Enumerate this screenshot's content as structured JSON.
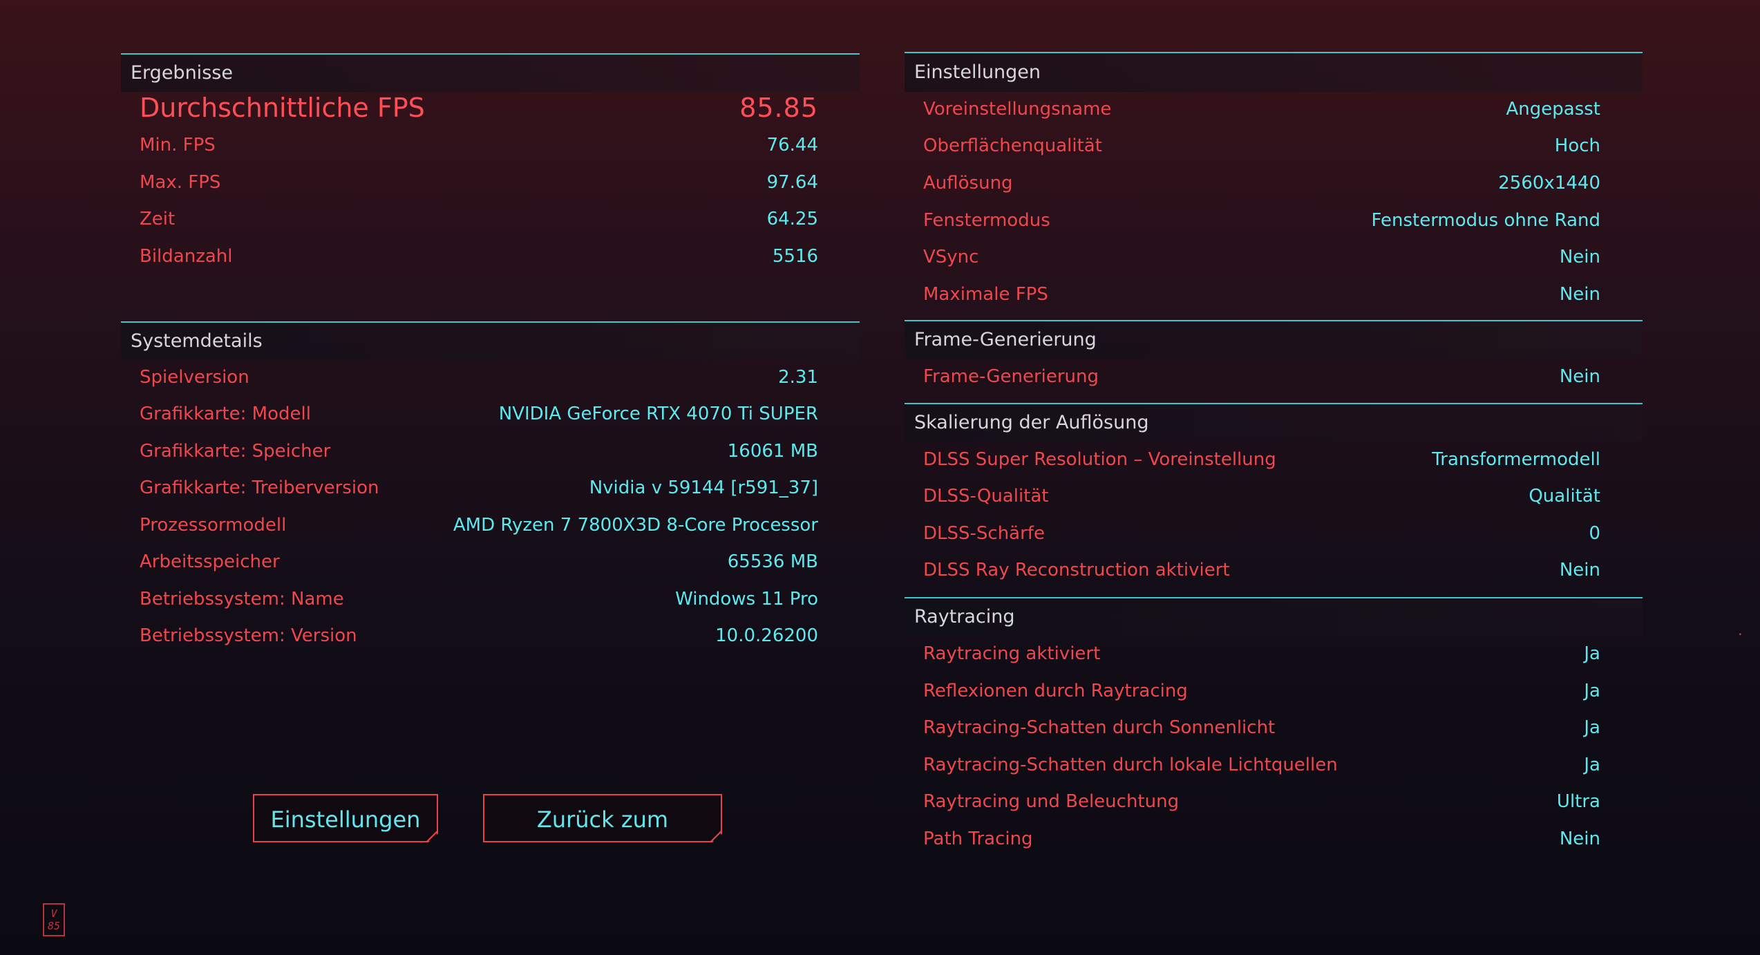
{
  "results": {
    "title": "Ergebnisse",
    "avg_fps_label": "Durchschnittliche FPS",
    "avg_fps_value": "85.85",
    "rows": [
      {
        "label": "Min. FPS",
        "value": "76.44"
      },
      {
        "label": "Max. FPS",
        "value": "97.64"
      },
      {
        "label": "Zeit",
        "value": "64.25"
      },
      {
        "label": "Bildanzahl",
        "value": "5516"
      }
    ]
  },
  "system": {
    "title": "Systemdetails",
    "rows": [
      {
        "label": "Spielversion",
        "value": "2.31"
      },
      {
        "label": "Grafikkarte: Modell",
        "value": "NVIDIA GeForce RTX 4070 Ti SUPER"
      },
      {
        "label": "Grafikkarte: Speicher",
        "value": "16061 MB"
      },
      {
        "label": "Grafikkarte: Treiberversion",
        "value": "Nvidia v 59144 [r591_37]"
      },
      {
        "label": "Prozessormodell",
        "value": "AMD Ryzen 7 7800X3D 8-Core Processor"
      },
      {
        "label": "Arbeitsspeicher",
        "value": "65536 MB"
      },
      {
        "label": "Betriebssystem: Name",
        "value": "Windows 11 Pro"
      },
      {
        "label": "Betriebssystem: Version",
        "value": "10.0.26200"
      }
    ]
  },
  "settings": {
    "title": "Einstellungen",
    "rows": [
      {
        "label": "Voreinstellungsname",
        "value": "Angepasst"
      },
      {
        "label": "Oberflächenqualität",
        "value": "Hoch"
      },
      {
        "label": "Auflösung",
        "value": "2560x1440"
      },
      {
        "label": "Fenstermodus",
        "value": "Fenstermodus ohne Rand"
      },
      {
        "label": "VSync",
        "value": "Nein"
      },
      {
        "label": "Maximale FPS",
        "value": "Nein"
      }
    ]
  },
  "frame_gen": {
    "title": "Frame-Generierung",
    "rows": [
      {
        "label": "Frame-Generierung",
        "value": "Nein"
      }
    ]
  },
  "scaling": {
    "title": "Skalierung der Auflösung",
    "rows": [
      {
        "label": "DLSS Super Resolution – Voreinstellung",
        "value": "Transformermodell"
      },
      {
        "label": "DLSS-Qualität",
        "value": "Qualität"
      },
      {
        "label": "DLSS-Schärfe",
        "value": "0"
      },
      {
        "label": "DLSS Ray Reconstruction aktiviert",
        "value": "Nein"
      }
    ]
  },
  "raytracing": {
    "title": "Raytracing",
    "rows": [
      {
        "label": "Raytracing aktiviert",
        "value": "Ja"
      },
      {
        "label": "Reflexionen durch Raytracing",
        "value": "Ja"
      },
      {
        "label": "Raytracing-Schatten durch Sonnenlicht",
        "value": "Ja"
      },
      {
        "label": "Raytracing-Schatten durch lokale Lichtquellen",
        "value": "Ja"
      },
      {
        "label": "Raytracing und Beleuchtung",
        "value": "Ultra"
      },
      {
        "label": "Path Tracing",
        "value": "Nein"
      }
    ]
  },
  "buttons": {
    "settings": "Einstellungen",
    "main_menu": "Zurück zum Hauptmenü"
  },
  "corner": {
    "logo": "V 85"
  }
}
